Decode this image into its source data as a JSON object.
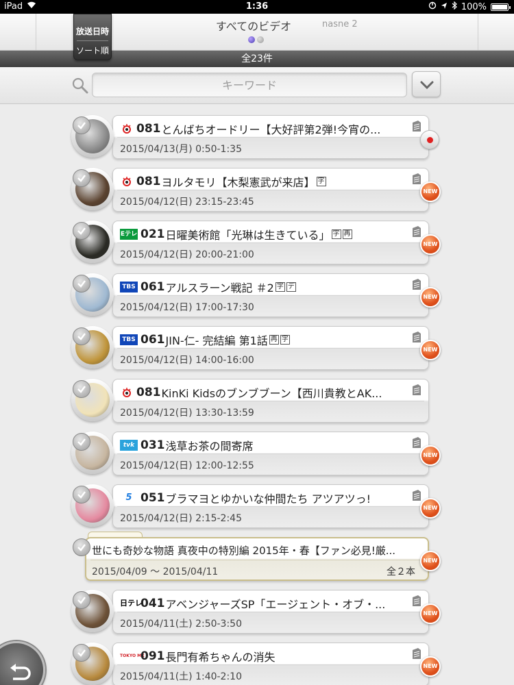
{
  "status_bar": {
    "device": "iPad",
    "time": "1:36",
    "battery": "100%",
    "battery_level": 1.0
  },
  "header": {
    "sort_button": {
      "line1": "放送日時",
      "line2": "ソート順"
    },
    "title": "すべてのビデオ",
    "device_name": "nasne 2",
    "page_dots": {
      "count": 2,
      "active": 0
    }
  },
  "count_label": "全23件",
  "search": {
    "placeholder": "キーワード"
  },
  "items": [
    {
      "channel_logo": "fuji-eye-logo",
      "channel": "081",
      "title": "とんばちオードリー【大好評第2弾!今宵の...",
      "subs": [],
      "date": "2015/04/13(月) 0:50-1:35",
      "badge": "recording",
      "thumb_color": "#8a8a8a"
    },
    {
      "channel_logo": "fuji-eye-logo",
      "channel": "081",
      "title": "ヨルタモリ【木梨憲武が来店】",
      "subs": [
        "字"
      ],
      "date": "2015/04/12(日) 23:15-23:45",
      "badge": "NEW",
      "thumb_color": "#5b4330"
    },
    {
      "channel_logo": "etele-logo",
      "logo_text": "Eテレ",
      "channel": "021",
      "title": "日曜美術館「光琳は生きている」",
      "subs": [
        "字",
        "再"
      ],
      "date": "2015/04/12(日) 20:00-21:00",
      "badge": "NEW",
      "thumb_color": "#2b2b25"
    },
    {
      "channel_logo": "tbs-logo",
      "logo_text": "TBS",
      "channel": "061",
      "title": "アルスラーン戦記 ＃2",
      "subs": [
        "字",
        "デ"
      ],
      "date": "2015/04/12(日) 17:00-17:30",
      "badge": "NEW",
      "thumb_color": "#9fb9d2"
    },
    {
      "channel_logo": "tbs-logo",
      "logo_text": "TBS",
      "channel": "061",
      "title": "JIN-仁- 完結編 第1話",
      "subs": [
        "再",
        "字"
      ],
      "date": "2015/04/12(日) 14:00-16:00",
      "badge": "NEW",
      "thumb_color": "#c0953b"
    },
    {
      "channel_logo": "fuji-eye-logo",
      "channel": "081",
      "title": "KinKi Kidsのブンブブーン【西川貴教とAK...",
      "subs": [],
      "date": "2015/04/12(日) 13:30-13:59",
      "badge": "",
      "thumb_color": "#f1e3b8"
    },
    {
      "channel_logo": "tvk-logo",
      "logo_text": "tvk",
      "channel": "031",
      "title": "浅草お茶の間寄席",
      "subs": [],
      "date": "2015/04/12(日) 12:00-12:55",
      "badge": "NEW",
      "thumb_color": "#c7b6a0"
    },
    {
      "channel_logo": "five-logo",
      "logo_text": "5",
      "channel": "051",
      "title": "ブラマヨとゆかいな仲間たち アツアツっ!",
      "subs": [],
      "date": "2015/04/12(日) 2:15-2:45",
      "badge": "NEW",
      "thumb_color": "#e58aa0"
    }
  ],
  "group": {
    "title": "世にも奇妙な物語 真夜中の特別編 2015年・春【ファン必見!厳...",
    "date_range": "2015/04/09 〜 2015/04/11",
    "count": "全２本",
    "badge": "NEW"
  },
  "items_after": [
    {
      "channel_logo": "ntv-logo",
      "logo_text": "日テレ",
      "channel": "041",
      "title": "アベンジャーズSP「エージェント・オブ・...",
      "subs": [],
      "date": "2015/04/11(土) 2:50-3:50",
      "badge": "NEW",
      "thumb_color": "#6e5238"
    },
    {
      "channel_logo": "tokyomx-logo",
      "logo_text": "TOKYO MX",
      "channel": "091",
      "title": "長門有希ちゃんの消失",
      "subs": [],
      "date": "2015/04/11(土) 1:40-2:10",
      "badge": "NEW",
      "thumb_color": "#b88a3e"
    }
  ],
  "new_badge_label": "NEW"
}
